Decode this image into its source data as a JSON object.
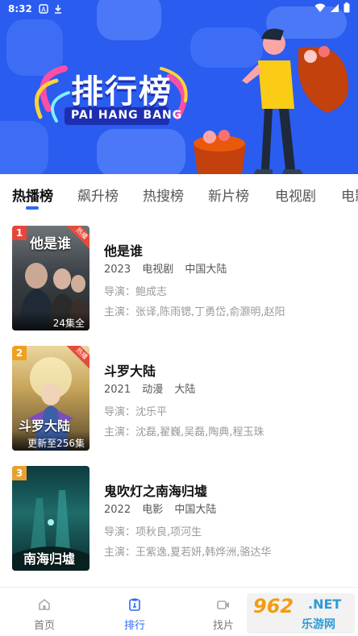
{
  "status_bar": {
    "time": "8:32"
  },
  "banner": {
    "title": "排行榜",
    "subtitle": "PAI HANG BANG"
  },
  "tabs": [
    {
      "label": "热播榜",
      "active": true
    },
    {
      "label": "飙升榜"
    },
    {
      "label": "热搜榜"
    },
    {
      "label": "新片榜"
    },
    {
      "label": "电视剧"
    },
    {
      "label": "电影"
    }
  ],
  "items": [
    {
      "rank": "1",
      "badge": "热播",
      "poster_title": "他是谁",
      "poster_status": "24集全",
      "name": "他是谁",
      "year": "2023",
      "type": "电视剧",
      "region": "中国大陆",
      "director": "导演：鲍成志",
      "cast": "主演：张译,陈雨锶,丁勇岱,俞灏明,赵阳"
    },
    {
      "rank": "2",
      "badge": "热播",
      "poster_title": "斗罗大陆",
      "poster_status": "更新至256集",
      "name": "斗罗大陆",
      "year": "2021",
      "type": "动漫",
      "region": "大陆",
      "director": "导演：沈乐平",
      "cast": "主演：沈磊,翟巍,吴磊,陶典,程玉珠"
    },
    {
      "rank": "3",
      "badge": "",
      "poster_title": "南海归墟",
      "poster_status": "",
      "name": "鬼吹灯之南海归墟",
      "year": "2022",
      "type": "电影",
      "region": "中国大陆",
      "director": "导演：项秋良,项河生",
      "cast": "主演：王紫逸,夏若妍,韩烨洲,骆达华"
    }
  ],
  "bottom_nav": [
    {
      "label": "首页",
      "icon": "home-icon"
    },
    {
      "label": "排行",
      "icon": "ranking-icon",
      "active": true
    },
    {
      "label": "找片",
      "icon": "video-icon"
    }
  ],
  "watermark": {
    "num": "962",
    "net": ".NET",
    "cn": "乐游网"
  },
  "colors": {
    "accent": "#2b6bf2",
    "banner": "#2a5cf0",
    "rank1": "#e6463a",
    "rank2": "#f0a020",
    "rank3": "#e8a030"
  }
}
